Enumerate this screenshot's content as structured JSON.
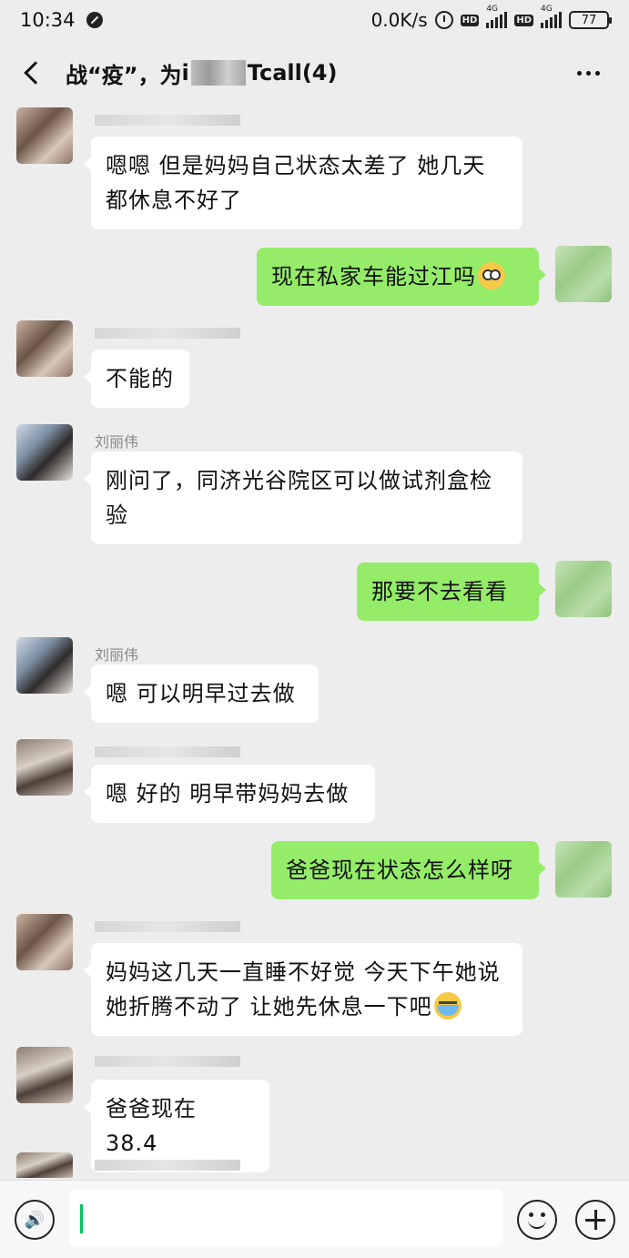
{
  "status_bar": {
    "time": "10:34",
    "net_speed": "0.0K/s",
    "signal_label_1": "4G",
    "signal_label_2": "4G",
    "hd_1": "HD",
    "hd_2": "HD",
    "battery": "77"
  },
  "header": {
    "title_prefix": "战“疫”，为",
    "title_mid": "i",
    "title_suffix": "Tcall(4)"
  },
  "messages": [
    {
      "direction": "in",
      "avatar": "avatar-a",
      "sender": "",
      "text": "嗯嗯 但是妈妈自己状态太差了 她几天都休息不好了"
    },
    {
      "direction": "out",
      "text": "现在私家车能过江吗",
      "emoji": "flushed-emoji"
    },
    {
      "direction": "in",
      "avatar": "avatar-a",
      "sender": "",
      "text": "不能的"
    },
    {
      "direction": "in",
      "avatar": "avatar-b",
      "sender": "刘丽伟",
      "text": "刚问了，同济光谷院区可以做试剂盒检验"
    },
    {
      "direction": "out",
      "text": "那要不去看看"
    },
    {
      "direction": "in",
      "avatar": "avatar-b",
      "sender": "刘丽伟",
      "text": "嗯 可以明早过去做"
    },
    {
      "direction": "in",
      "avatar": "avatar-c",
      "sender": "",
      "text": "嗯 好的 明早带妈妈去做"
    },
    {
      "direction": "out",
      "text": "爸爸现在状态怎么样呀"
    },
    {
      "direction": "in",
      "avatar": "avatar-a",
      "sender": "",
      "text": "妈妈这几天一直睡不好觉 今天下午她说她折腾不动了 让她先休息一下吧",
      "emoji": "crying-emoji"
    },
    {
      "direction": "in",
      "avatar": "avatar-c",
      "sender": "",
      "text": "爸爸现在 38.4"
    }
  ],
  "input_bar": {
    "voice_icon": "voice-icon",
    "emoji_icon": "emoji-icon",
    "plus_icon": "plus-icon",
    "draft": ""
  }
}
